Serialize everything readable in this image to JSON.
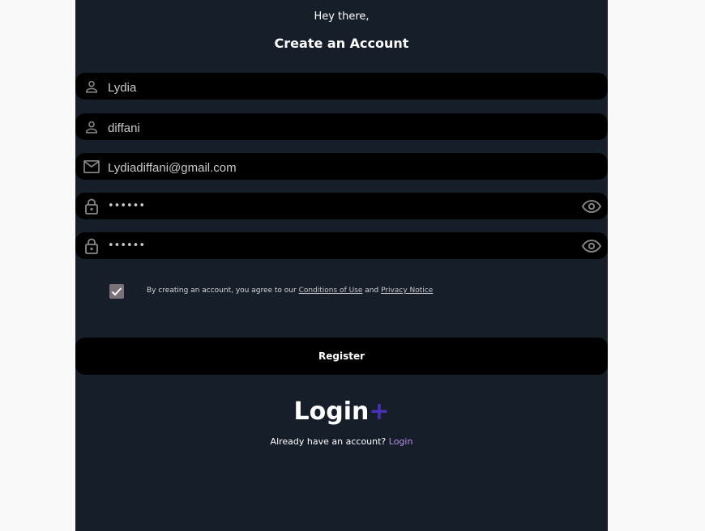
{
  "header": {
    "greeting": "Hey there,",
    "title": "Create an Account"
  },
  "form": {
    "first_name": {
      "value": "Lydia",
      "icon": "person-icon"
    },
    "last_name": {
      "value": "diffani",
      "icon": "person-icon"
    },
    "email": {
      "value": "Lydiadiffani@gmail.com",
      "icon": "mail-icon"
    },
    "password": {
      "value": "••••••",
      "icon": "lock-icon"
    },
    "confirm_password": {
      "value": "••••••",
      "icon": "lock-icon"
    }
  },
  "agreement": {
    "checked": true,
    "prefix": "By creating an account, you agree to our ",
    "conditions_link": "Conditions of Use",
    "and": " and ",
    "privacy_link": "Privacy Notice"
  },
  "register_label": "Register",
  "logo": {
    "text": "Login",
    "plus": "+",
    "plus_color": "#4a2fb8"
  },
  "footer": {
    "prompt": "Already have an account? ",
    "login_link": "Login"
  },
  "colors": {
    "panel_bg": "#161e29",
    "field_bg": "#000000",
    "link_accent": "#b98fe8"
  }
}
